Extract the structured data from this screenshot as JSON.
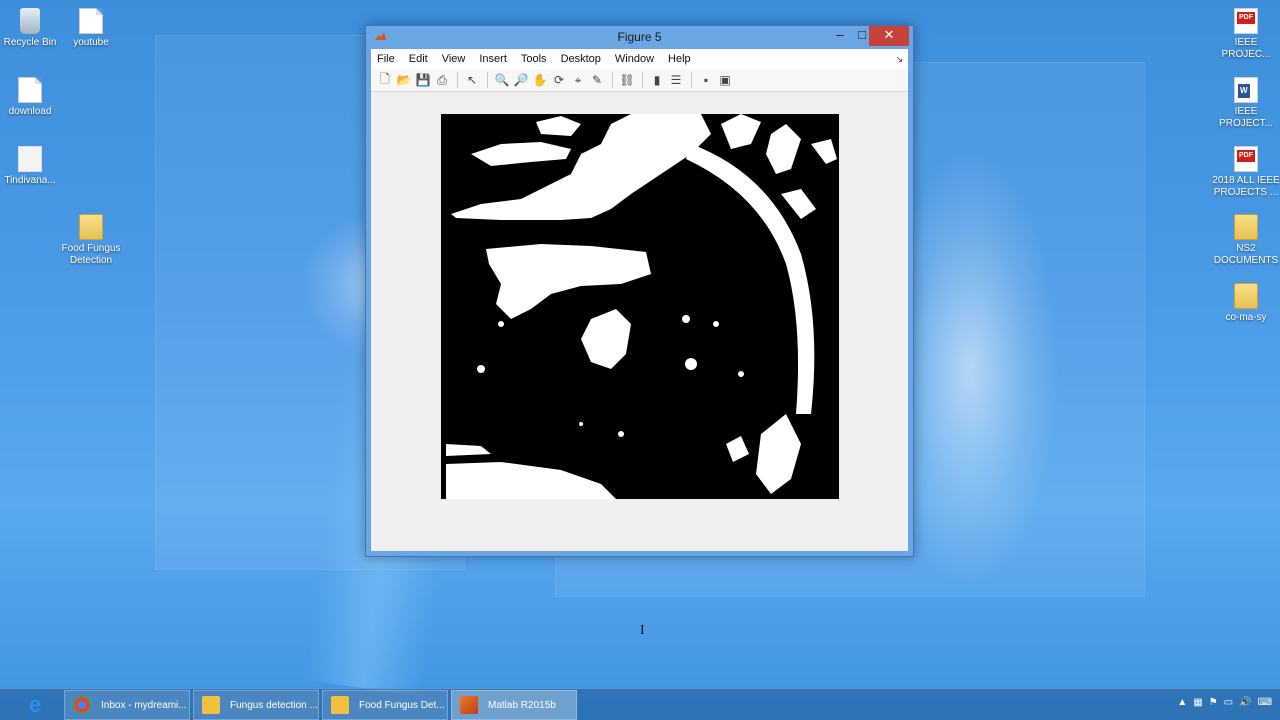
{
  "desktop": {
    "icons_left": [
      {
        "label": "Recycle Bin",
        "icon": "recycle-bin-icon"
      },
      {
        "label": "youtube",
        "icon": "document-icon"
      },
      {
        "label": "download",
        "icon": "document-icon"
      },
      {
        "label": "Tindivana...",
        "icon": "image-file-icon"
      },
      {
        "label": "Food Fungus Detection",
        "icon": "folder-icon"
      }
    ],
    "icons_right": [
      {
        "label": "IEEE PROJEC...",
        "icon": "pdf-icon"
      },
      {
        "label": "IEEE PROJECT...",
        "icon": "word-doc-icon"
      },
      {
        "label": "2018 ALL IEEE PROJECTS ...",
        "icon": "pdf-icon"
      },
      {
        "label": "NS2 DOCUMENTS",
        "icon": "folder-icon"
      },
      {
        "label": "co-ma-sy",
        "icon": "folder-icon"
      }
    ]
  },
  "window": {
    "title": "Figure 5",
    "controls": {
      "minimize": "–",
      "maximize": "□",
      "close": "✕"
    },
    "menu": [
      "File",
      "Edit",
      "View",
      "Insert",
      "Tools",
      "Desktop",
      "Window",
      "Help"
    ],
    "dock_glyph": "↘",
    "toolbar": [
      {
        "name": "new-figure-icon",
        "glyph": "🗋"
      },
      {
        "name": "open-file-icon",
        "glyph": "📂"
      },
      {
        "name": "save-icon",
        "glyph": "💾"
      },
      {
        "name": "print-icon",
        "glyph": "⎙"
      },
      {
        "name": "edit-plot-icon",
        "glyph": "↖"
      },
      {
        "name": "zoom-in-icon",
        "glyph": "🔍"
      },
      {
        "name": "zoom-out-icon",
        "glyph": "🔎"
      },
      {
        "name": "pan-icon",
        "glyph": "✋"
      },
      {
        "name": "rotate-3d-icon",
        "glyph": "⟳"
      },
      {
        "name": "data-cursor-icon",
        "glyph": "⌖"
      },
      {
        "name": "brush-icon",
        "glyph": "✎"
      },
      {
        "name": "link-plot-icon",
        "glyph": "⛓"
      },
      {
        "name": "colorbar-icon",
        "glyph": "▮"
      },
      {
        "name": "legend-icon",
        "glyph": "☰"
      },
      {
        "name": "hide-plot-tools-icon",
        "glyph": "▪"
      },
      {
        "name": "show-plot-tools-icon",
        "glyph": "▣"
      }
    ]
  },
  "taskbar": {
    "ie_glyph": "e",
    "tasks": [
      {
        "label": "Inbox - mydreami...",
        "icon": "chrome-icon",
        "color": "#e94235"
      },
      {
        "label": "Fungus detection ...",
        "icon": "folder-icon",
        "color": "#f0c040"
      },
      {
        "label": "Food Fungus Det...",
        "icon": "folder-icon",
        "color": "#f0c040"
      },
      {
        "label": "Matlab R2015b",
        "icon": "matlab-icon",
        "color": "#e0601c"
      }
    ],
    "tray_glyphs": [
      "▲",
      "▦",
      "⚑",
      "▭",
      "🔊",
      "⌨"
    ]
  },
  "cursor_glyph": "I"
}
